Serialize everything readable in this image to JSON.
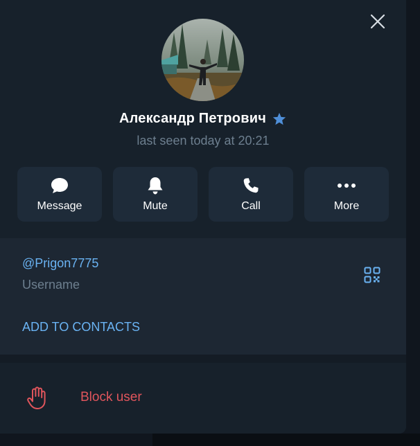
{
  "profile": {
    "name": "Александр Петрович",
    "status": "last seen today at 20:21",
    "verified_star_color": "#4f8fd8",
    "avatar": "photo-of-man-in-forest"
  },
  "actions": [
    {
      "label": "Message",
      "icon": "message-icon"
    },
    {
      "label": "Mute",
      "icon": "bell-icon"
    },
    {
      "label": "Call",
      "icon": "phone-icon"
    },
    {
      "label": "More",
      "icon": "more-dots-icon"
    }
  ],
  "info": {
    "username": "@Prigon7775",
    "username_label": "Username",
    "add_to_contacts": "ADD TO CONTACTS",
    "qr_icon": "qr-code-icon"
  },
  "danger": {
    "block_label": "Block user",
    "block_icon": "hand-stop-icon",
    "color": "#e0555c"
  },
  "colors": {
    "panel_bg": "#17212b",
    "accent": "#6ab3f3",
    "muted_text": "#6d7f8f"
  }
}
